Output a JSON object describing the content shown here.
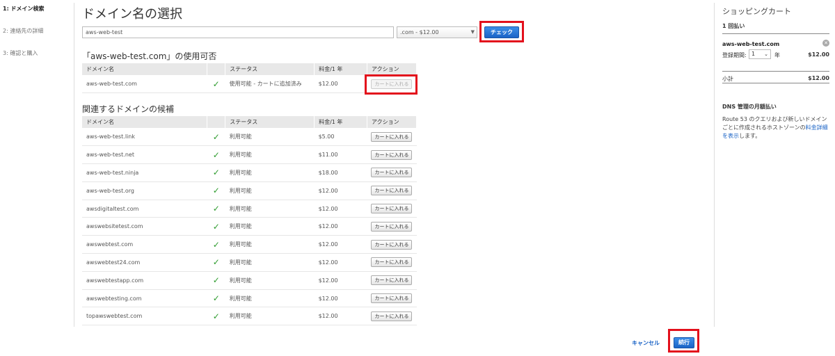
{
  "steps": [
    {
      "label": "1: ドメイン検索",
      "active": true
    },
    {
      "label": "2: 連絡先の詳細",
      "active": false
    },
    {
      "label": "3: 確認と購入",
      "active": false
    }
  ],
  "main": {
    "title": "ドメイン名の選択",
    "search": {
      "value": "aws-web-test"
    },
    "tld_select": {
      "value": ".com - $12.00"
    },
    "check_label": "チェック"
  },
  "availability": {
    "title": "「aws-web-test.com」の使用可否",
    "headers": {
      "name": "ドメイン名",
      "status": "ステータス",
      "price": "料金/1 年",
      "action": "アクション"
    },
    "row": {
      "name": "aws-web-test.com",
      "status": "使用可能 - カートに追加済み",
      "price": "$12.00",
      "action": "カートに入れる"
    }
  },
  "suggestions": {
    "title": "関連するドメインの候補",
    "headers": {
      "name": "ドメイン名",
      "status": "ステータス",
      "price": "料金/1 年",
      "action": "アクション"
    },
    "rows": [
      {
        "name": "aws-web-test.link",
        "status": "利用可能",
        "price": "$5.00",
        "action": "カートに入れる"
      },
      {
        "name": "aws-web-test.net",
        "status": "利用可能",
        "price": "$11.00",
        "action": "カートに入れる"
      },
      {
        "name": "aws-web-test.ninja",
        "status": "利用可能",
        "price": "$18.00",
        "action": "カートに入れる"
      },
      {
        "name": "aws-web-test.org",
        "status": "利用可能",
        "price": "$12.00",
        "action": "カートに入れる"
      },
      {
        "name": "awsdigitaltest.com",
        "status": "利用可能",
        "price": "$12.00",
        "action": "カートに入れる"
      },
      {
        "name": "awswebsitetest.com",
        "status": "利用可能",
        "price": "$12.00",
        "action": "カートに入れる"
      },
      {
        "name": "awswebtest.com",
        "status": "利用可能",
        "price": "$12.00",
        "action": "カートに入れる"
      },
      {
        "name": "awswebtest24.com",
        "status": "利用可能",
        "price": "$12.00",
        "action": "カートに入れる"
      },
      {
        "name": "awswebtestapp.com",
        "status": "利用可能",
        "price": "$12.00",
        "action": "カートに入れる"
      },
      {
        "name": "awswebtesting.com",
        "status": "利用可能",
        "price": "$12.00",
        "action": "カートに入れる"
      },
      {
        "name": "topawswebtest.com",
        "status": "利用可能",
        "price": "$12.00",
        "action": "カートに入れる"
      }
    ]
  },
  "footer": {
    "cancel_label": "キャンセル",
    "next_label": "続行"
  },
  "cart": {
    "title": "ショッピングカート",
    "subtitle": "1 回払い",
    "item": {
      "domain": "aws-web-test.com",
      "period_label": "登録期間:",
      "period_value": "1",
      "period_unit": "年",
      "price": "$12.00"
    },
    "subtotal_label": "小計",
    "subtotal_value": "$12.00",
    "dns_title": "DNS 管理の月額払い",
    "dns_text_before": "Route 53 のクエリおよび新しいドメインごとに作成されるホストゾーンの",
    "dns_link": "料金詳細を表示",
    "dns_text_after": "します。"
  },
  "colors": {
    "primary": "#1a63c6",
    "highlight": "#e3101c",
    "check": "#2d9b2d"
  },
  "icons": {
    "available": "check-icon",
    "remove": "remove-circle-icon",
    "dropdown": "chevron-down-icon"
  }
}
